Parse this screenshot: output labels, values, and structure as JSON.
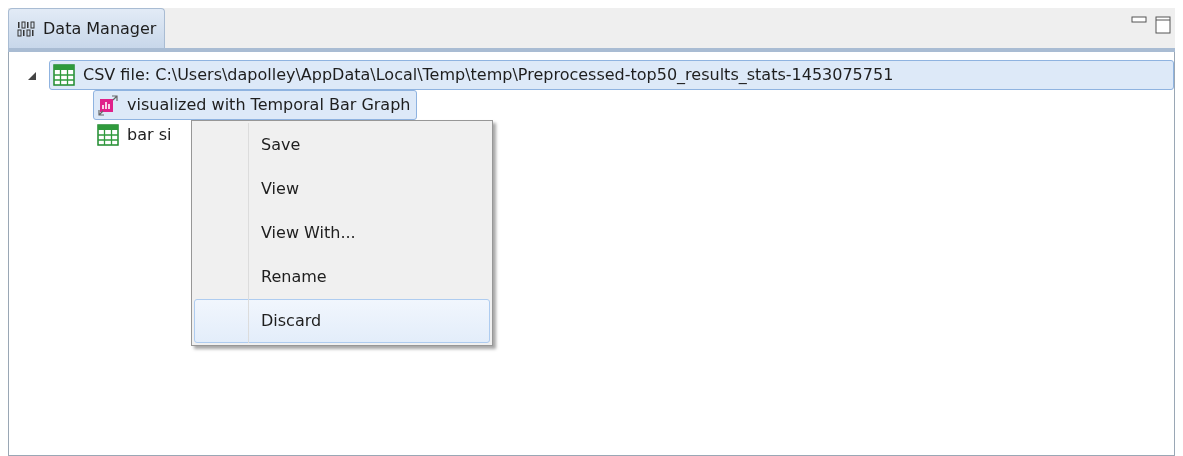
{
  "view": {
    "tab": {
      "label": "Data Manager",
      "selected": true
    }
  },
  "tree": [
    {
      "label": "CSV file: C:\\Users\\dapolley\\AppData\\Local\\Temp\\temp\\Preprocessed-top50_results_stats-1453075751",
      "kind": "table",
      "selected": true,
      "expanded": true,
      "children": [
        {
          "label": "visualized with Temporal Bar Graph",
          "kind": "chart",
          "selected": true
        },
        {
          "label": "bar si",
          "kind": "table",
          "selected": false
        }
      ]
    }
  ],
  "context_menu": [
    {
      "label": "Save",
      "selected": false
    },
    {
      "label": "View",
      "selected": false
    },
    {
      "label": "View With...",
      "selected": false
    },
    {
      "label": "Rename",
      "selected": false
    },
    {
      "label": "Discard",
      "selected": true
    }
  ]
}
